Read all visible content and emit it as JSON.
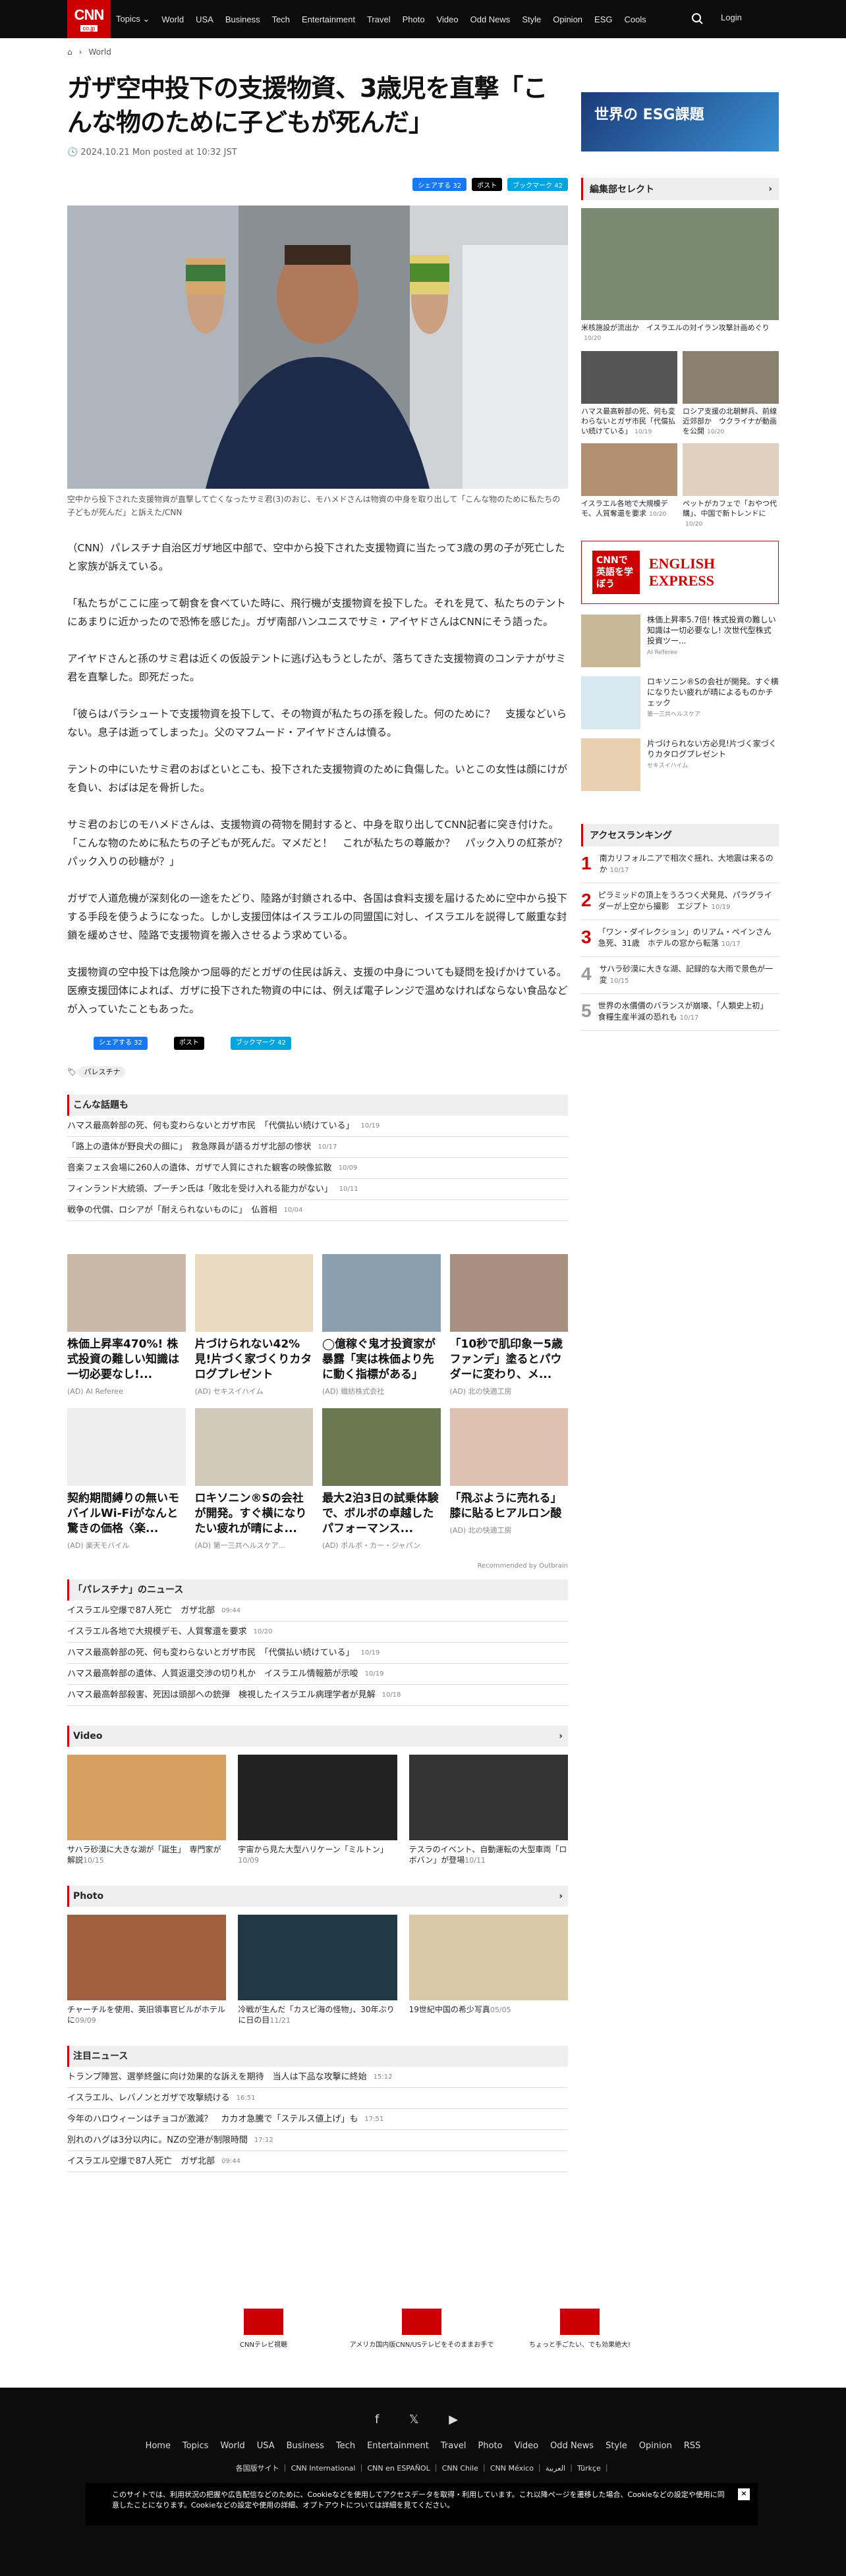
{
  "nav": {
    "logo": "CNN",
    "logo_sub": "co.jp",
    "items": [
      "Topics ⌄",
      "World",
      "USA",
      "Business",
      "Tech",
      "Entertainment",
      "Travel",
      "Photo",
      "Video",
      "Odd News",
      "Style",
      "Opinion",
      "ESG",
      "Cools"
    ],
    "login": "Login"
  },
  "crumb": {
    "section": "World"
  },
  "article": {
    "title": "ガザ空中投下の支援物資、3歳児を直撃「こんな物のために子どもが死んだ」",
    "date": "2024.10.21 Mon posted at 10:32 JST",
    "share_fb": "シェアする 32",
    "share_x": "ポスト",
    "share_hb": "ブックマーク 42",
    "caption": "空中から投下された支援物資が直撃して亡くなったサミ君(3)のおじ、モハメドさんは物資の中身を取り出して「こんな物のために私たちの子どもが死んだ」と訴えた/CNN",
    "paragraphs": [
      "（CNN）パレスチナ自治区ガザ地区中部で、空中から投下された支援物資に当たって3歳の男の子が死亡したと家族が訴えている。",
      "「私たちがここに座って朝食を食べていた時に、飛行機が支援物資を投下した。それを見て、私たちのテントにあまりに近かったので恐怖を感じた」。ガザ南部ハンユニスでサミ・アイヤドさんはCNNにそう語った。",
      "アイヤドさんと孫のサミ君は近くの仮設テントに逃げ込もうとしたが、落ちてきた支援物資のコンテナがサミ君を直撃した。即死だった。",
      "「彼らはパラシュートで支援物資を投下して、その物資が私たちの孫を殺した。何のために？　支援などいらない。息子は逝ってしまった」。父のマフムード・アイヤドさんは憤る。",
      "テントの中にいたサミ君のおばといとこも、投下された支援物資のために負傷した。いとこの女性は顔にけがを負い、おばは足を骨折した。",
      "サミ君のおじのモハメドさんは、支援物資の荷物を開封すると、中身を取り出してCNN記者に突き付けた。「こんな物のために私たちの子どもが死んだ。マメだと！　これが私たちの尊厳か？　パック入りの紅茶が？　パック入りの砂糖が？」",
      "ガザで人道危機が深刻化の一途をたどり、陸路が封鎖される中、各国は食料支援を届けるために空中から投下する手段を使うようになった。しかし支援団体はイスラエルの同盟国に対し、イスラエルを説得して厳重な封鎖を緩めさせ、陸路で支援物資を搬入させるよう求めている。",
      "支援物資の空中投下は危険かつ屈辱的だとガザの住民は訴え、支援の中身についても疑問を投げかけている。医療支援団体によれば、ガザに投下された物資の中には、例えば電子レンジで温めなければならない食品などが入っていたこともあった。"
    ],
    "tag": "パレスチナ"
  },
  "related": {
    "title": "こんな話題も",
    "items": [
      [
        "ハマス最高幹部の死、何も変わらないとガザ市民　「代償払い続けている」",
        "10/19"
      ],
      [
        "「路上の遺体が野良犬の餌に」　救急隊員が語るガザ北部の惨状",
        "10/17"
      ],
      [
        "音楽フェス会場に260人の遺体、ガザで人質にされた観客の映像拡散",
        "10/09"
      ],
      [
        "フィンランド大統領、プーチン氏は「敗北を受け入れる能力がない」",
        "10/11"
      ],
      [
        "戦争の代償、ロシアが「耐えられないものに」　仏首相",
        "10/04"
      ]
    ]
  },
  "ads": [
    [
      "株価上昇率470%! 株式投資の難しい知識は一切必要なし!...",
      "(AD) AI Referee"
    ],
    [
      "片づけられない42% 見!片づく家づくりカタログプレゼント",
      "(AD) セキスイハイム"
    ],
    [
      "◯億稼ぐ鬼才投資家が暴露「実は株価より先に動く指標がある」",
      "(AD) 織紡株式会社"
    ],
    [
      "「10秒で肌印象ー5歳ファンデ」塗るとパウダーに変わり、メ...",
      "(AD) 北の快適工房"
    ],
    [
      "契約期間縛りの無いモバイルWi-Fiがなんと驚きの価格〈楽...",
      "(AD) 楽天モバイル"
    ],
    [
      "ロキソニン®Sの会社が開発。すぐ横になりたい疲れが晴によ...",
      "(AD) 第一三共ヘルスケア..."
    ],
    [
      "最大2泊3日の試乗体験で、ボルボの卓越したパフォーマンス...",
      "(AD) ボルボ・カー・ジャパン"
    ],
    [
      "「飛ぶように売れる」膝に貼るヒアルロン酸",
      "(AD) 北の快適工房"
    ]
  ],
  "recommended": "Recommended by Outbrain",
  "palestine": {
    "title": "「パレスチナ」のニュース",
    "items": [
      [
        "イスラエル空爆で87人死亡　ガザ北部",
        "09:44"
      ],
      [
        "イスラエル各地で大規模デモ、人質奪還を要求",
        "10/20"
      ],
      [
        "ハマス最高幹部の死、何も変わらないとガザ市民　「代償払い続けている」",
        "10/19"
      ],
      [
        "ハマス最高幹部の遺体、人質返還交渉の切り札か　イスラエル情報筋が示唆",
        "10/19"
      ],
      [
        "ハマス最高幹部殺害、死因は頭部への銃弾　検視したイスラエル病理学者が見解",
        "10/18"
      ]
    ]
  },
  "video": {
    "title": "Video",
    "items": [
      [
        "サハラ砂漠に大きな湖が「誕生」　専門家が解説",
        "10/15"
      ],
      [
        "宇宙から見た大型ハリケーン「ミルトン」",
        "10/09"
      ],
      [
        "テスラのイベント、自動運転の大型車両「ロボバン」が登場",
        "10/11"
      ]
    ]
  },
  "photo": {
    "title": "Photo",
    "items": [
      [
        "チャーチルを使用、英旧領事官ビルがホテルに",
        "09/09"
      ],
      [
        "冷戦が生んだ「カスピ海の怪物」、30年ぶりに日の目",
        "11/21"
      ],
      [
        "19世紀中国の希少写真",
        "05/05"
      ]
    ]
  },
  "notice": {
    "title": "注目ニュース",
    "items": [
      [
        "トランプ陣営、選挙終盤に向け効果的な訴えを期待　当人は下品な攻撃に終始",
        "15:12"
      ],
      [
        "イスラエル、レバノンとガザで攻撃続ける",
        "16:51"
      ],
      [
        "今年のハロウィーンはチョコが激減？　カカオ急騰で「ステルス値上げ」も",
        "17:51"
      ],
      [
        "別れのハグは3分以内に。NZの空港が制限時間",
        "17:12"
      ],
      [
        "イスラエル空爆で87人死亡　ガザ北部",
        "09:44"
      ]
    ]
  },
  "sidebar": {
    "esg": "世界の ESG課題",
    "editor": "編集部セレクト",
    "editor_items": [
      [
        "米核施設が流出か　イスラエルの対イラン攻撃計画めぐり",
        "10/20"
      ],
      [
        "ハマス最高幹部の死、何も変わらないとガザ市民「代償払い続けている」",
        "10/19"
      ],
      [
        "ロシア支援の北朝鮮兵、前線近郊部か　ウクライナが動画を公開",
        "10/20"
      ],
      [
        "イスラエル各地で大規模デモ、人質奪還を要求",
        "10/20"
      ],
      [
        "ペットがカフェで「おやつ代購」、中国で新トレンドに",
        "10/20"
      ]
    ],
    "english": "CNNで 英語を学ぼう",
    "ads": [
      [
        "株価上昇率5.7倍! 株式投資の難しい知識は一切必要なし! 次世代型株式投資ツー...",
        "AI Referee"
      ],
      [
        "ロキソニン®Sの会社が開発。すぐ横になりたい疲れが晴によるものかチェック",
        "第一三共ヘルスケア"
      ],
      [
        "片づけられない方必見!片づく家づくりカタログプレゼント",
        "セキスイハイム"
      ]
    ],
    "ranking": "アクセスランキング",
    "ranks": [
      [
        "南カリフォルニアで相次ぐ揺れ、大地震は来るのか",
        "10/17"
      ],
      [
        "ピラミッドの頂上をうろつく犬発見、パラグライダーが上空から撮影　エジプト",
        "10/19"
      ],
      [
        "「ワン・ダイレクション」のリアム・ペインさん急死、31歳　ホテルの窓から転落",
        "10/17"
      ],
      [
        "サハラ砂漠に大きな湖、記録的な大雨で景色が一変",
        "10/15"
      ],
      [
        "世界の水價價のバランスが崩壊、「人類史上初」　食糧生産半減の恐れも",
        "10/17"
      ]
    ]
  },
  "footer": {
    "brands": [
      "CNNテレビ視聴",
      "アメリカ国内版CNN/USテレビをそのままお手で",
      "ちょっと手ごたい、でも効果絶大!"
    ],
    "links": [
      "Home",
      "Topics",
      "World",
      "USA",
      "Business",
      "Tech",
      "Entertainment",
      "Travel",
      "Photo",
      "Video",
      "Odd News",
      "Style",
      "Opinion",
      "RSS"
    ],
    "intl": "各国版サイト ｜ CNN International ｜ CNN en ESPAÑOL ｜ CNN Chile ｜ CNN México ｜ العربية ｜ Türkçe ｜",
    "cookie": "このサイトでは、利用状況の把握や広告配信などのために、Cookieなどを使用してアクセスデータを取得・利用しています。これ以降ページを遷移した場合、Cookieなどの設定や使用に同意したことになります。Cookieなどの設定や使用の詳細、オプトアウトについては詳細を見てください。"
  }
}
